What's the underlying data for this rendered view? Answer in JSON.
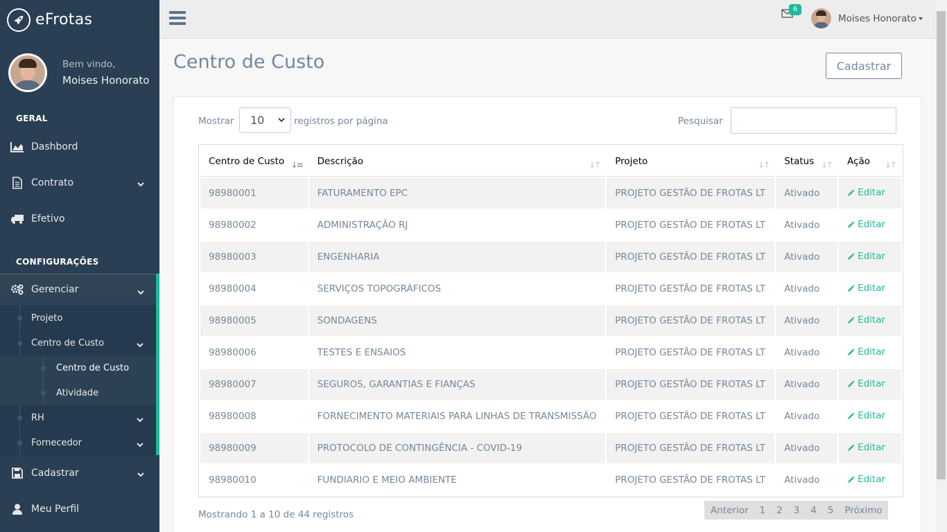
{
  "brand": {
    "name": "eFrotas"
  },
  "profile": {
    "welcome": "Bem vindo,",
    "name": "Moises Honorato"
  },
  "sidebar": {
    "section_general": "GERAL",
    "section_config": "CONFIGURAÇÕES",
    "dashboard": "Dashbord",
    "contrato": "Contrato",
    "efetivo": "Efetivo",
    "gerenciar": "Gerenciar",
    "projeto": "Projeto",
    "centro_custo": "Centro de Custo",
    "centro_custo_sub": "Centro de Custo",
    "atividade": "Atividade",
    "rh": "RH",
    "fornecedor": "Fornecedor",
    "cadastrar": "Cadastrar",
    "meu_perfil": "Meu Perfil"
  },
  "topbar": {
    "mail_count": "6",
    "user_name": "Moises Honorato"
  },
  "page": {
    "title": "Centro de Custo",
    "cadastrar_button": "Cadastrar"
  },
  "controls": {
    "show_label": "Mostrar",
    "page_size": "10",
    "per_page_label": "registros por página",
    "search_label": "Pesquisar"
  },
  "table": {
    "headers": [
      "Centro de Custo",
      "Descrição",
      "Projeto",
      "Status",
      "Ação"
    ],
    "edit_label": "Editar",
    "rows": [
      {
        "code": "98980001",
        "desc": "FATURAMENTO EPC",
        "project": "PROJETO GESTÃO DE FROTAS LT",
        "status": "Ativado"
      },
      {
        "code": "98980002",
        "desc": "ADMINISTRAÇÃO RJ",
        "project": "PROJETO GESTÃO DE FROTAS LT",
        "status": "Ativado"
      },
      {
        "code": "98980003",
        "desc": "ENGENHARIA",
        "project": "PROJETO GESTÃO DE FROTAS LT",
        "status": "Ativado"
      },
      {
        "code": "98980004",
        "desc": "SERVIÇOS TOPOGRÁFICOS",
        "project": "PROJETO GESTÃO DE FROTAS LT",
        "status": "Ativado"
      },
      {
        "code": "98980005",
        "desc": "SONDAGENS",
        "project": "PROJETO GESTÃO DE FROTAS LT",
        "status": "Ativado"
      },
      {
        "code": "98980006",
        "desc": "TESTES E ENSAIOS",
        "project": "PROJETO GESTÃO DE FROTAS LT",
        "status": "Ativado"
      },
      {
        "code": "98980007",
        "desc": "SEGUROS, GARANTIAS E FIANÇAS",
        "project": "PROJETO GESTÃO DE FROTAS LT",
        "status": "Ativado"
      },
      {
        "code": "98980008",
        "desc": "FORNECIMENTO MATERIAIS PARA LINHAS DE TRANSMISSÃO",
        "project": "PROJETO GESTÃO DE FROTAS LT",
        "status": "Ativado"
      },
      {
        "code": "98980009",
        "desc": "PROTOCOLO DE CONTINGÊNCIA - COVID-19",
        "project": "PROJETO GESTÃO DE FROTAS LT",
        "status": "Ativado"
      },
      {
        "code": "98980010",
        "desc": "FUNDIARIO E MEIO AMBIENTE",
        "project": "PROJETO GESTÃO DE FROTAS LT",
        "status": "Ativado"
      }
    ]
  },
  "footer": {
    "info": "Mostrando 1 a 10 de 44 registros",
    "prev": "Anterior",
    "pages": [
      "1",
      "2",
      "3",
      "4",
      "5"
    ],
    "next": "Próximo"
  },
  "colors": {
    "sidebar": "#2a3f54",
    "accent": "#1abb9c",
    "link": "#26b99a",
    "text": "#73879c"
  },
  "icons": [
    "rocket-icon",
    "chart-area-icon",
    "file-icon",
    "truck-icon",
    "gears-icon",
    "chevron-down-icon",
    "save-icon",
    "user-icon",
    "envelope-icon",
    "bars-icon",
    "pencil-icon",
    "sort-icon"
  ]
}
